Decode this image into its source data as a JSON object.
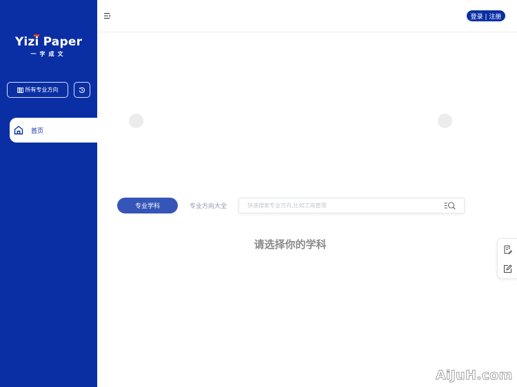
{
  "brand": {
    "logo_text": "Yizi Paper",
    "logo_subtitle": "一字成文",
    "primary_color": "#0a2fa4",
    "accent_color": "#e84a2a"
  },
  "sidebar": {
    "all_directions_label": "所有专业方向",
    "all_directions_icon": "books-icon",
    "history_icon": "history-icon",
    "items": [
      {
        "label": "首页",
        "icon": "home-icon",
        "active": true
      }
    ]
  },
  "header": {
    "menu_icon": "menu-collapse-icon",
    "auth_label": "登录 | 注册"
  },
  "carousel": {
    "prev_icon": "carousel-prev-arrow",
    "next_icon": "carousel-next-arrow"
  },
  "search": {
    "tabs": [
      {
        "label": "专业学科",
        "active": true
      },
      {
        "label": "专业方向大全",
        "active": false
      }
    ],
    "placeholder": "快速搜索专业方向,比如工商管理",
    "value": ""
  },
  "main": {
    "prompt": "请选择你的学科"
  },
  "float_toolbar": {
    "items": [
      {
        "icon": "document-edit-icon"
      },
      {
        "icon": "pencil-square-icon"
      }
    ]
  },
  "watermark": "AiJuH.com"
}
